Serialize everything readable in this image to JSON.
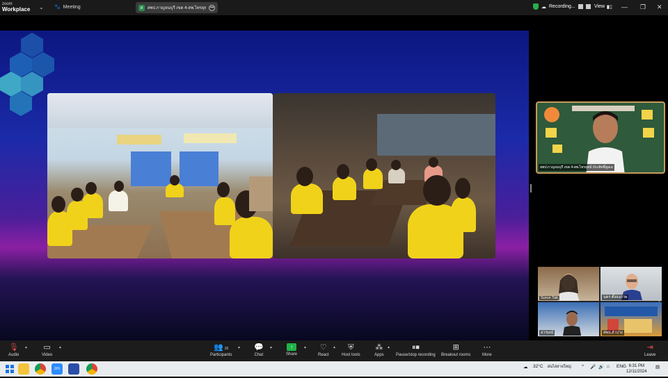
{
  "titlebar": {
    "brand_top": "zoom",
    "brand_bottom": "Workplace",
    "meeting_label": "Meeting",
    "meeting_tab_title": "สพป.กาญจนบุรี เขต 4-สพ.ไทรยุทธ์ ประ",
    "recording_label": "Recording...",
    "view_label": "View"
  },
  "speaker": {
    "name": "สพป.กาญจนบุรี เขต 4-สพ.ไทรยุทธ์ ประสิทธิ์พูลเจ"
  },
  "gallery": [
    {
      "name": "Surun Tati"
    },
    {
      "name": "นคร ตั้งจงภาพ"
    },
    {
      "name": "อารมณ์"
    },
    {
      "name": "สพป.ลำปาง"
    }
  ],
  "toolbar": {
    "audio": "Audio",
    "video": "Video",
    "participants": "Participants",
    "participants_count": "26",
    "chat": "Chat",
    "share": "Share",
    "react": "React",
    "host_tools": "Host tools",
    "apps": "Apps",
    "recording": "Pause/stop recording",
    "breakout": "Breakout rooms",
    "more": "More",
    "leave": "Leave"
  },
  "taskbar": {
    "weather": "32°C",
    "weather_desc": "ฝนไล่สายใหญ่",
    "lang": "ENG",
    "time": "6:31 PM",
    "date": "12/11/2024"
  },
  "colors": {
    "accent_share": "#1fb347",
    "leave": "#e24b4b",
    "stage_top": "#0c1780",
    "stage_mid": "#8b1fa3"
  }
}
